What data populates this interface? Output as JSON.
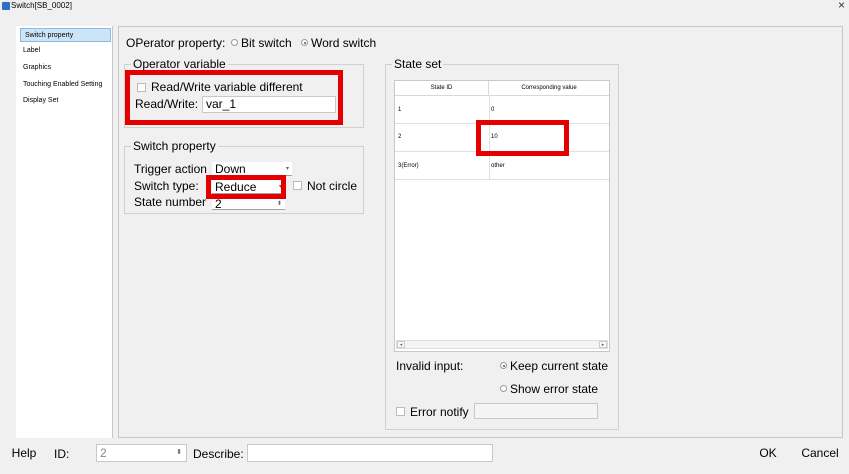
{
  "window": {
    "title": "Switch[SB_0002]",
    "close_glyph": "×"
  },
  "nav": {
    "items": [
      {
        "label": "Switch property",
        "selected": true
      },
      {
        "label": "Label",
        "selected": false
      },
      {
        "label": "Graphics",
        "selected": false
      },
      {
        "label": "Touching Enabled Setting",
        "selected": false
      },
      {
        "label": "Display Set",
        "selected": false
      }
    ]
  },
  "operator_property": {
    "label": "OPerator property:",
    "options": [
      {
        "label": "Bit switch",
        "selected": false
      },
      {
        "label": "Word switch",
        "selected": true
      }
    ]
  },
  "operator_variable": {
    "title": "Operator variable",
    "rw_different_label": "Read/Write variable different",
    "rw_different_checked": false,
    "read_write_label": "Read/Write:",
    "read_write_value": "var_1"
  },
  "switch_property": {
    "title": "Switch property",
    "trigger_action_label": "Trigger action",
    "trigger_action_value": "Down",
    "switch_type_label": "Switch type:",
    "switch_type_value": "Reduce",
    "not_circle_label": "Not circle",
    "not_circle_checked": false,
    "state_number_label": "State number",
    "state_number_value": "2"
  },
  "state_set": {
    "title": "State set",
    "columns": [
      "State ID",
      "Corresponding value"
    ],
    "rows": [
      [
        "1",
        "0"
      ],
      [
        "2",
        "10"
      ],
      [
        "3(Error)",
        "other"
      ]
    ],
    "invalid_input_label": "Invalid input:",
    "invalid_options": [
      {
        "label": "Keep current state",
        "selected": true
      },
      {
        "label": "Show error state",
        "selected": false
      }
    ],
    "error_notify_label": "Error notify",
    "error_notify_checked": false,
    "error_notify_value": ""
  },
  "bottom": {
    "help_label": "Help",
    "id_label": "ID:",
    "id_value": "2",
    "describe_label": "Describe:",
    "describe_value": "",
    "ok_label": "OK",
    "cancel_label": "Cancel"
  },
  "colors": {
    "highlight": "#e40000",
    "nav_selected": "#cce4f7"
  }
}
